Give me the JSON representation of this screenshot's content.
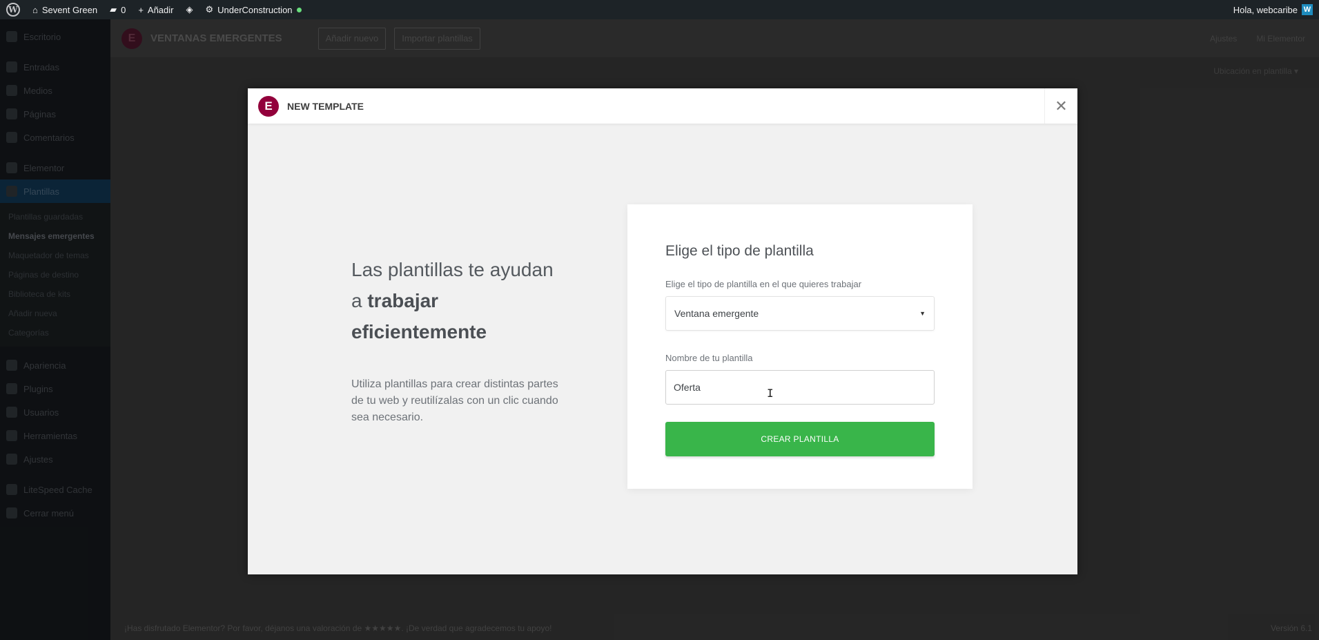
{
  "adminbar": {
    "site_name": "Sevent Green",
    "comments_count": "0",
    "add_new": "Añadir",
    "under_construction": "UnderConstruction",
    "greeting": "Hola, webcaribe",
    "avatar_letter": "W"
  },
  "sidebar": {
    "items_top": [
      "Escritorio",
      "Entradas",
      "Medios",
      "Páginas",
      "Comentarios",
      "Elementor"
    ],
    "active": "Plantillas",
    "submenu": [
      "Plantillas guardadas",
      "Mensajes emergentes",
      "Maquetador de temas",
      "Páginas de destino",
      "Biblioteca de kits",
      "Añadir nueva",
      "Categorías"
    ],
    "current_sub": "Mensajes emergentes",
    "items_bottom": [
      "Apariencia",
      "Plugins",
      "Usuarios",
      "Herramientas",
      "Ajustes"
    ],
    "items_extra": [
      "LiteSpeed Cache",
      "Cerrar menú"
    ]
  },
  "main": {
    "logo": "E",
    "title": "VENTANAS EMERGENTES",
    "add_new": "Añadir nuevo",
    "import": "Importar plantillas",
    "header_right": [
      "Ajustes",
      "Mi Elementor"
    ],
    "filter": "Ubicación en plantilla ▾",
    "footer": "¡Has disfrutado Elementor? Por favor, déjanos una valoración de ★★★★★. ¡De verdad que agradecemos tu apoyo!",
    "version": "Versión 6.1"
  },
  "modal": {
    "logo": "E",
    "title": "New Template",
    "close": "✕",
    "intro_title_1": "Las plantillas te ayudan a ",
    "intro_title_bold": "trabajar eficientemente",
    "intro_text": "Utiliza plantillas para crear distintas partes de tu web y reutilízalas con un clic cuando sea necesario.",
    "form": {
      "title": "Elige el tipo de plantilla",
      "type_label": "Elige el tipo de plantilla en el que quieres trabajar",
      "type_value": "Ventana emergente",
      "type_arrow": "▼",
      "name_label": "Nombre de tu plantilla",
      "name_value": "Oferta",
      "submit": "Crear plantilla"
    }
  },
  "cursor": "I"
}
